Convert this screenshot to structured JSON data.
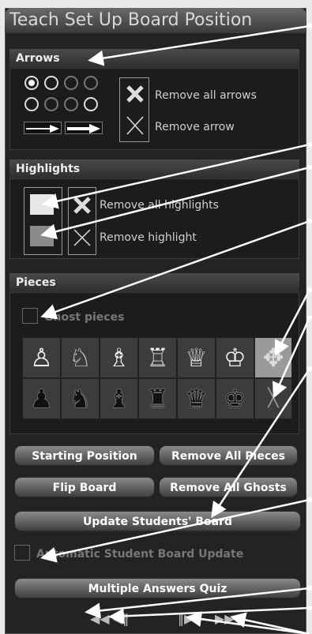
{
  "title": "Teach Set Up Board Position",
  "arrows": {
    "heading": "Arrows",
    "remove_all": "Remove all arrows",
    "remove_one": "Remove arrow"
  },
  "highlights": {
    "heading": "Highlights",
    "remove_all": "Remove all highlights",
    "remove_one": "Remove highlight"
  },
  "pieces": {
    "heading": "Pieces",
    "ghost_label": "Ghost pieces",
    "white_row": [
      "♙",
      "♘",
      "♗",
      "♖",
      "♕",
      "♔"
    ],
    "black_row": [
      "♟",
      "♞",
      "♝",
      "♜",
      "♛",
      "♚"
    ],
    "move_tool": "✥",
    "erase_tool": "╳"
  },
  "buttons": {
    "starting_position": "Starting Position",
    "remove_all_pieces": "Remove All Pieces",
    "flip_board": "Flip Board",
    "remove_all_ghosts": "Remove All Ghosts",
    "update_students": "Update Students' Board",
    "multiple_answers": "Multiple Answers Quiz"
  },
  "auto_update_label": "Automatic Student Board Update",
  "nav": {
    "first": "◀◀",
    "prev": "◀‖",
    "next": "‖▶",
    "last": "▶▶"
  }
}
